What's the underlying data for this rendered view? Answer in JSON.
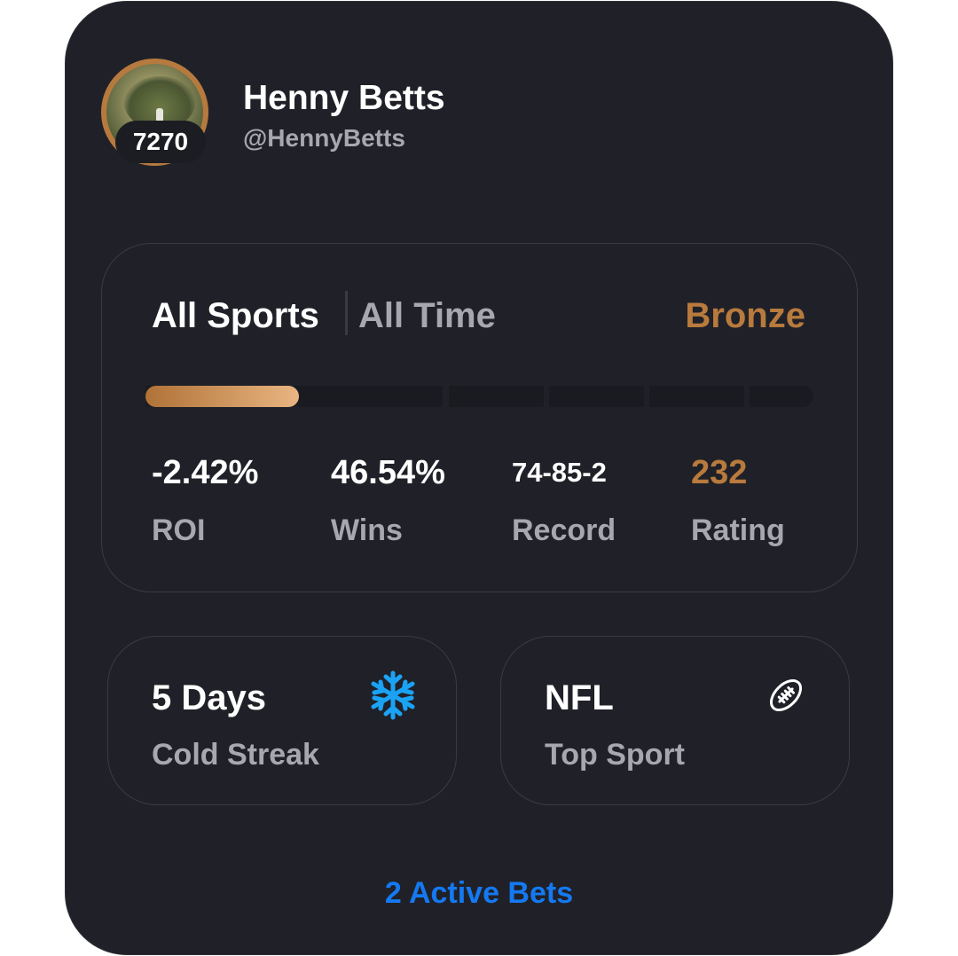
{
  "profile": {
    "name": "Henny Betts",
    "handle": "@HennyBetts",
    "badge_number": "7270"
  },
  "stats_panel": {
    "sport_filter": "All Sports",
    "time_filter": "All Time",
    "tier": "Bronze",
    "tier_progress": 0.23,
    "stats": [
      {
        "value": "-2.42%",
        "label": "ROI"
      },
      {
        "value": "46.54%",
        "label": "Wins"
      },
      {
        "value": "74-85-2",
        "label": "Record"
      },
      {
        "value": "232",
        "label": "Rating"
      }
    ]
  },
  "streak_card": {
    "value": "5 Days",
    "label": "Cold Streak",
    "icon": "snowflake-icon"
  },
  "top_sport_card": {
    "value": "NFL",
    "label": "Top Sport",
    "icon": "football-icon"
  },
  "footer": {
    "active_bets": "2 Active Bets"
  },
  "colors": {
    "card_bg": "#202128",
    "accent_bronze": "#b87a3d",
    "link_blue": "#1479f2",
    "snowflake_blue": "#1aa3f5",
    "muted_text": "#a7a8ae"
  }
}
